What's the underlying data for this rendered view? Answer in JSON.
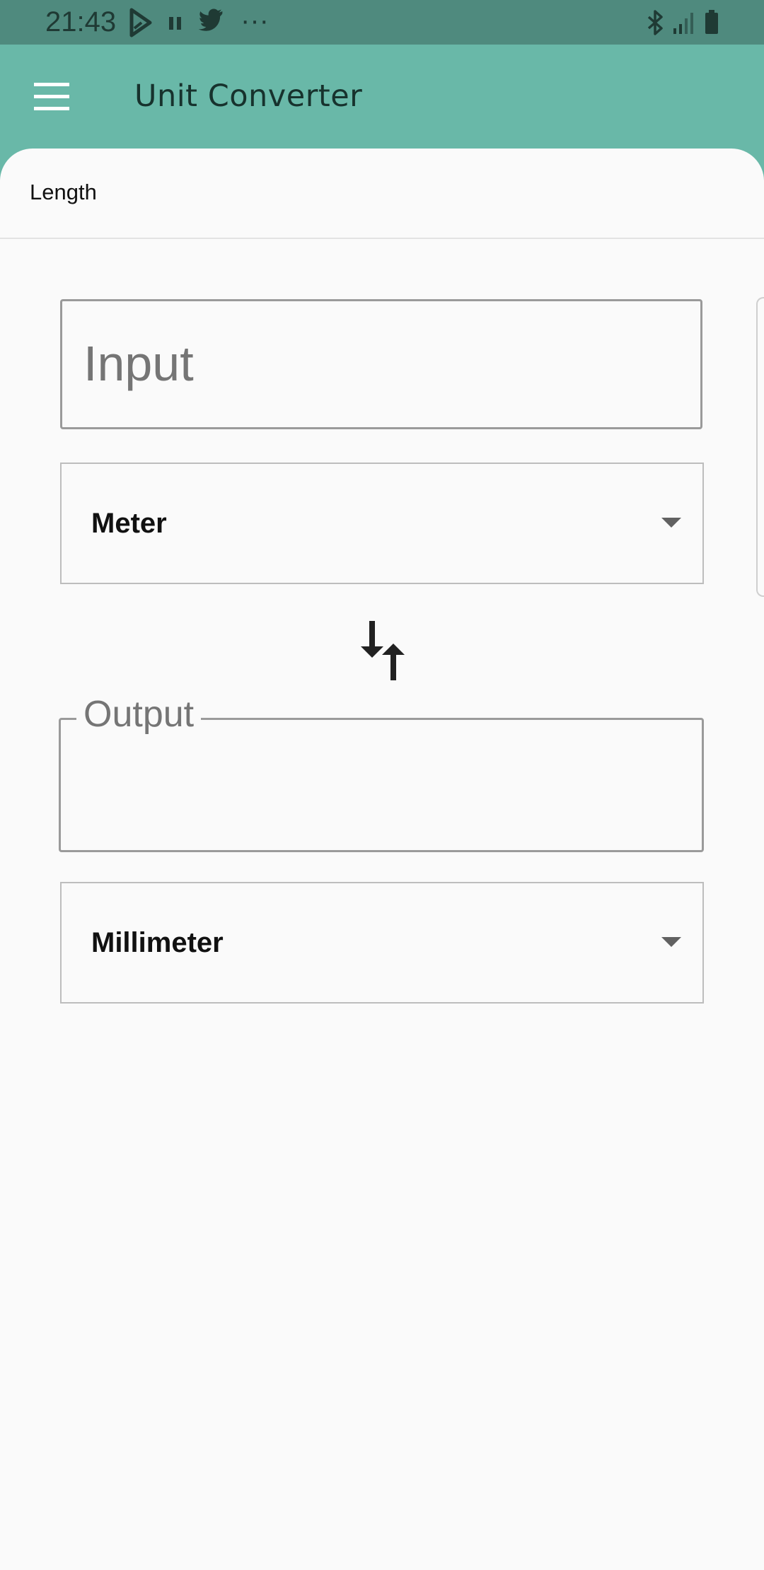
{
  "status_bar": {
    "time": "21:43",
    "icons": [
      "play-store-icon",
      "pause-icon",
      "twitter-icon",
      "more-icon",
      "bluetooth-icon",
      "signal-icon",
      "battery-icon"
    ],
    "more_glyph": "···"
  },
  "app_bar": {
    "title": "Unit Converter",
    "background": "#69b8a8",
    "menu_icon": "menu-icon"
  },
  "tab": {
    "label": "Length"
  },
  "converter": {
    "input": {
      "placeholder": "Input",
      "value": ""
    },
    "from_unit": "Meter",
    "swap_icon": "swap-vertical-icon",
    "output": {
      "label": "Output",
      "value": ""
    },
    "to_unit": "Millimeter"
  },
  "colors": {
    "accent": "#69b8a8",
    "status_bar": "#4f8a7e",
    "surface": "#fafafa"
  }
}
